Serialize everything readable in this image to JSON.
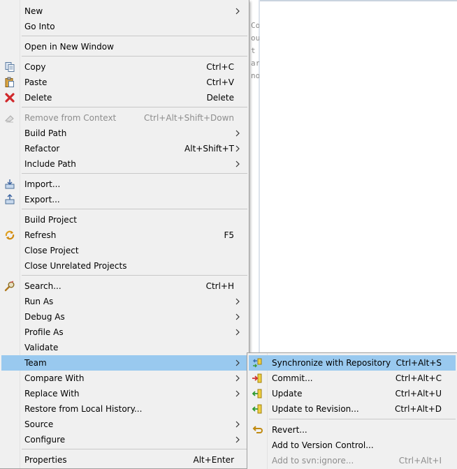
{
  "editor": {
    "code_fragments": [
      "Co",
      "ou",
      "t",
      "are",
      "no"
    ]
  },
  "main_menu": {
    "new": {
      "label": "New"
    },
    "go_into": {
      "label": "Go Into"
    },
    "open_new_window": {
      "label": "Open in New Window"
    },
    "copy": {
      "label": "Copy",
      "shortcut": "Ctrl+C",
      "icon": "copy-icon"
    },
    "paste": {
      "label": "Paste",
      "shortcut": "Ctrl+V",
      "icon": "paste-icon"
    },
    "delete": {
      "label": "Delete",
      "shortcut": "Delete",
      "icon": "delete-icon"
    },
    "remove_from_context": {
      "label": "Remove from Context",
      "shortcut": "Ctrl+Alt+Shift+Down",
      "icon": "remove-context-icon",
      "disabled": true
    },
    "build_path": {
      "label": "Build Path"
    },
    "refactor": {
      "label": "Refactor",
      "shortcut": "Alt+Shift+T"
    },
    "include_path": {
      "label": "Include Path"
    },
    "import": {
      "label": "Import...",
      "icon": "import-icon"
    },
    "export": {
      "label": "Export...",
      "icon": "export-icon"
    },
    "build_project": {
      "label": "Build Project"
    },
    "refresh": {
      "label": "Refresh",
      "shortcut": "F5",
      "icon": "refresh-icon"
    },
    "close_project": {
      "label": "Close Project"
    },
    "close_unrelated": {
      "label": "Close Unrelated Projects"
    },
    "search": {
      "label": "Search...",
      "shortcut": "Ctrl+H",
      "icon": "search-icon"
    },
    "run_as": {
      "label": "Run As"
    },
    "debug_as": {
      "label": "Debug As"
    },
    "profile_as": {
      "label": "Profile As"
    },
    "validate": {
      "label": "Validate"
    },
    "team": {
      "label": "Team",
      "highlighted": true
    },
    "compare_with": {
      "label": "Compare With"
    },
    "replace_with": {
      "label": "Replace With"
    },
    "restore_local_history": {
      "label": "Restore from Local History..."
    },
    "source": {
      "label": "Source"
    },
    "configure": {
      "label": "Configure"
    },
    "properties": {
      "label": "Properties",
      "shortcut": "Alt+Enter"
    }
  },
  "team_submenu": {
    "synchronize": {
      "label": "Synchronize with Repository",
      "shortcut": "Ctrl+Alt+S",
      "icon": "synchronize-icon",
      "highlighted": true
    },
    "commit": {
      "label": "Commit...",
      "shortcut": "Ctrl+Alt+C",
      "icon": "commit-icon"
    },
    "update": {
      "label": "Update",
      "shortcut": "Ctrl+Alt+U",
      "icon": "update-icon"
    },
    "update_revision": {
      "label": "Update to Revision...",
      "shortcut": "Ctrl+Alt+D",
      "icon": "update-revision-icon"
    },
    "revert": {
      "label": "Revert...",
      "icon": "revert-icon"
    },
    "add_version_control": {
      "label": "Add to Version Control..."
    },
    "add_svn_ignore": {
      "label": "Add to svn:ignore...",
      "shortcut": "Ctrl+Alt+I",
      "disabled": true
    }
  },
  "colors": {
    "menu_bg": "#f0f0f0",
    "highlight": "#99c9ef",
    "disabled_text": "#8d8d8d",
    "separator": "#c8c8c8"
  }
}
